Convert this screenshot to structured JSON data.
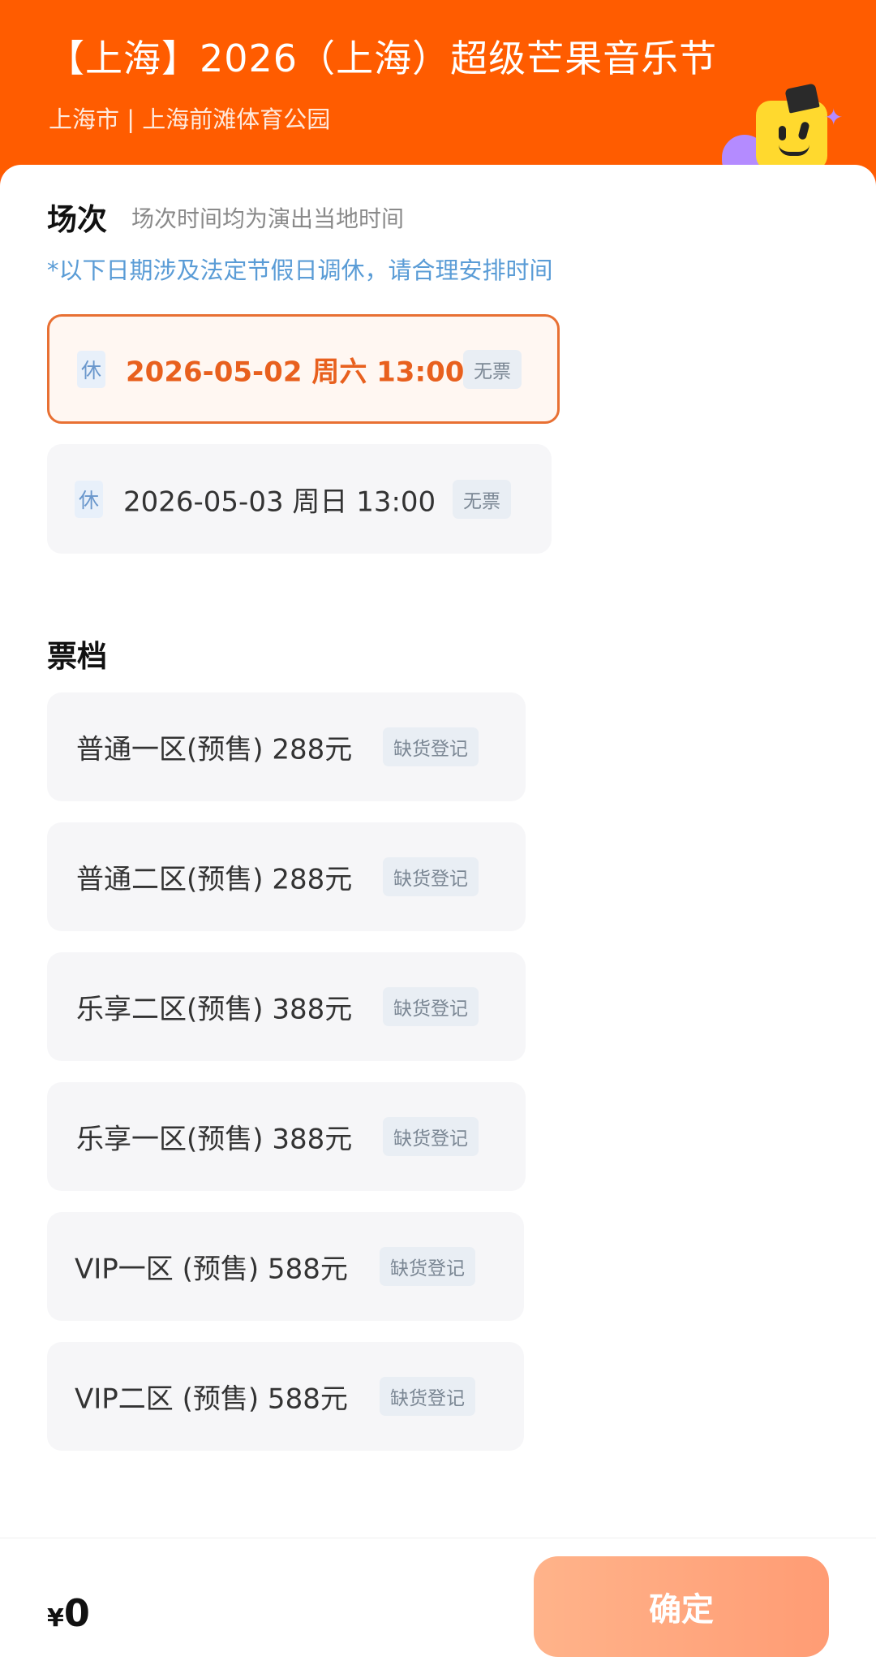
{
  "header": {
    "title": "【上海】2026（上海）超级芒果音乐节",
    "subtitle": "上海市 | 上海前滩体育公园"
  },
  "sessions": {
    "title": "场次",
    "hint": "场次时间均为演出当地时间",
    "notice": "*以下日期涉及法定节假日调休，请合理安排时间",
    "items": [
      {
        "rest": "休",
        "label": "2026-05-02  周六 13:00",
        "tag": "无票",
        "selected": true
      },
      {
        "rest": "休",
        "label": "2026-05-03 周日 13:00",
        "tag": "无票",
        "selected": false
      }
    ]
  },
  "tickets": {
    "title": "票档",
    "items": [
      {
        "label": "普通一区(预售) 288元",
        "tag": "缺货登记"
      },
      {
        "label": "普通二区(预售) 288元",
        "tag": "缺货登记"
      },
      {
        "label": "乐享二区(预售) 388元",
        "tag": "缺货登记"
      },
      {
        "label": "乐享一区(预售) 388元",
        "tag": "缺货登记"
      },
      {
        "label": "VIP一区 (预售) 588元",
        "tag": "缺货登记"
      },
      {
        "label": "VIP二区 (预售) 588元",
        "tag": "缺货登记"
      }
    ]
  },
  "footer": {
    "currency": "¥",
    "amount": "0",
    "confirm": "确定"
  },
  "colors": {
    "brand": "#ff5c00",
    "selected": "#e8601e",
    "notice": "#5a9cd6"
  }
}
